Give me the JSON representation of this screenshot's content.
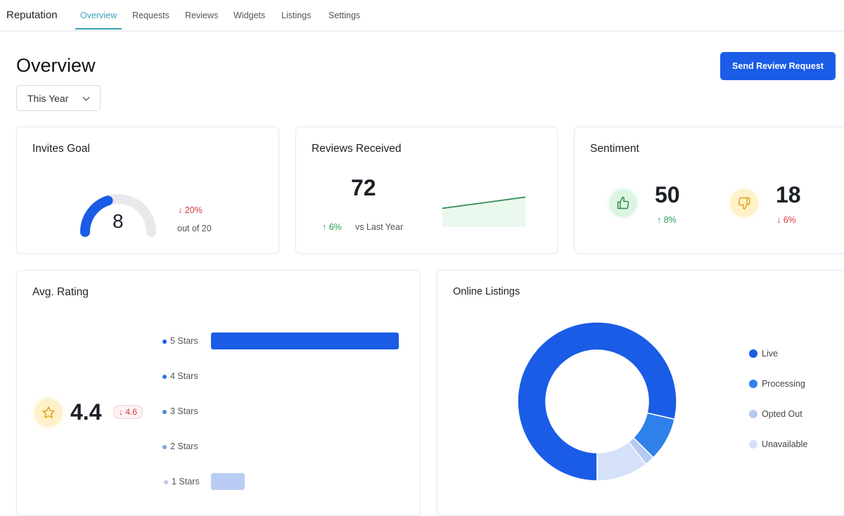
{
  "nav": {
    "brand": "Reputation",
    "tabs": [
      "Overview",
      "Requests",
      "Reviews",
      "Widgets",
      "Listings",
      "Settings"
    ],
    "active": "Overview"
  },
  "header": {
    "title": "Overview",
    "period": "This Year",
    "send_button": "Send Review Request"
  },
  "invites_goal": {
    "title": "Invites Goal",
    "value": 8,
    "goal": 20,
    "value_label": "8",
    "change": "↓ 20%",
    "out_of": "out of 20"
  },
  "reviews_received": {
    "title": "Reviews Received",
    "value": "72",
    "change": "↑ 6%",
    "compare": "vs Last Year",
    "trend": [
      40,
      60
    ]
  },
  "sentiment": {
    "title": "Sentiment",
    "positive": {
      "value": "50",
      "change": "↑ 8%"
    },
    "negative": {
      "value": "18",
      "change": "↓ 6%"
    }
  },
  "avg_rating": {
    "title": "Avg. Rating",
    "value": "4.4",
    "previous": "↓ 4.6"
  },
  "chart_data": [
    {
      "type": "bar",
      "title": "Avg. Rating",
      "categories": [
        "5 Stars",
        "4 Stars",
        "3 Stars",
        "2 Stars",
        "1 Stars"
      ],
      "values": [
        100,
        0,
        0,
        0,
        18
      ],
      "colors": [
        "#1a5ce6",
        "#2a72e0",
        "#4f86d9",
        "#7fa3e3",
        "#b9c7ea"
      ]
    },
    {
      "type": "pie",
      "title": "Online Listings",
      "categories": [
        "Live",
        "Processing",
        "Opted Out",
        "Unavailable"
      ],
      "values": [
        78.6,
        8.9,
        2,
        10.5
      ],
      "colors": [
        "#1a5ce6",
        "#2f80ea",
        "#b6c9f2",
        "#d4e1f8"
      ]
    }
  ]
}
